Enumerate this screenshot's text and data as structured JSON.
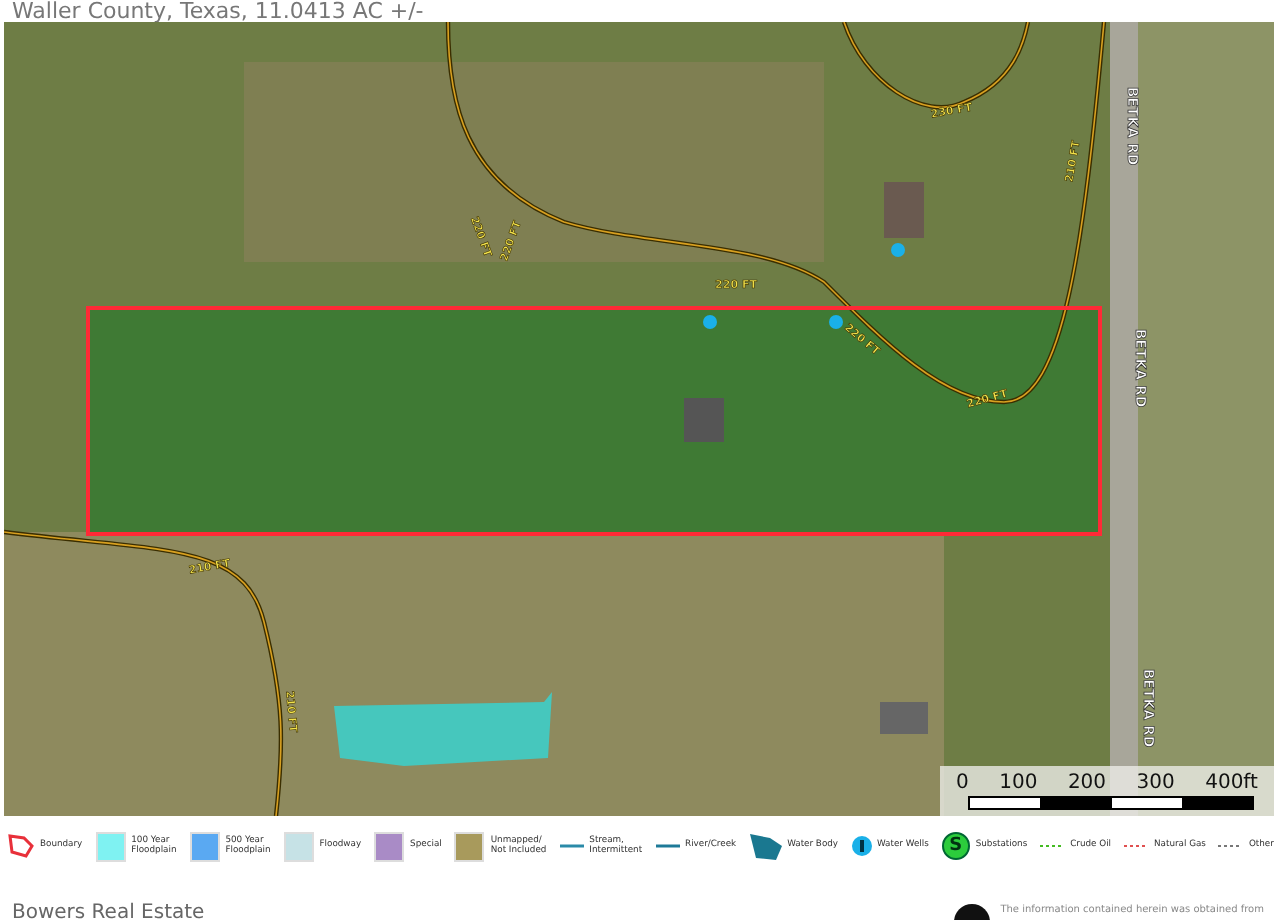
{
  "title": "Waller County, Texas, 11.0413 AC +/-",
  "map": {
    "road_labels": [
      "BETKA RD",
      "BETKA RD",
      "BETKA RD"
    ],
    "contour_labels": [
      "230 FT",
      "220 FT",
      "220 FT",
      "220 FT",
      "220 FT",
      "220 FT",
      "210 FT",
      "210 FT",
      "210 FT"
    ],
    "scale_bar": {
      "ticks": [
        "0",
        "100",
        "200",
        "300",
        "400ft"
      ]
    }
  },
  "legend": [
    {
      "kind": "outline",
      "label": [
        "Boundary"
      ],
      "color": "#e8303a"
    },
    {
      "kind": "swatch",
      "label": [
        "100 Year",
        "Floodplain"
      ],
      "color": "#7ff2f2"
    },
    {
      "kind": "swatch",
      "label": [
        "500 Year",
        "Floodplain"
      ],
      "color": "#5aa9f2"
    },
    {
      "kind": "swatch",
      "label": [
        "Floodway"
      ],
      "color": "#c6e2e6"
    },
    {
      "kind": "swatch",
      "label": [
        "Special"
      ],
      "color": "#a98bc6"
    },
    {
      "kind": "swatch",
      "label": [
        "Unmapped/",
        "Not Included"
      ],
      "color": "#a89a5c"
    },
    {
      "kind": "line",
      "label": [
        "Stream,",
        "Intermittent"
      ],
      "color": "#2a8aa8"
    },
    {
      "kind": "line",
      "label": [
        "River/Creek"
      ],
      "color": "#1e7a98"
    },
    {
      "kind": "shape",
      "label": [
        "Water Body"
      ],
      "color": "#1a7890"
    },
    {
      "kind": "well",
      "label": [
        "Water Wells"
      ],
      "color": "#1ab0e8"
    },
    {
      "kind": "substation",
      "label": [
        "Substations"
      ],
      "color": "#2ccc3c",
      "symbol": "S"
    },
    {
      "kind": "dotted",
      "label": [
        "Crude Oil"
      ],
      "color": "#44bb22"
    },
    {
      "kind": "dotted",
      "label": [
        "Natural Gas"
      ],
      "color": "#e05050"
    },
    {
      "kind": "dotted",
      "label": [
        "Other"
      ],
      "color": "#777777"
    }
  ],
  "footer": {
    "company": "Bowers Real Estate",
    "disclaimer": "The information contained herein was obtained from"
  }
}
